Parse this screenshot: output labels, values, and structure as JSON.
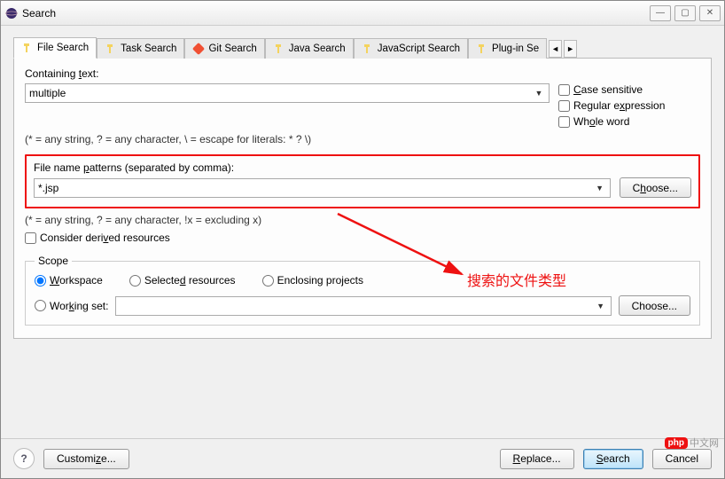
{
  "window": {
    "title": "Search"
  },
  "tabs": [
    {
      "label": "File Search"
    },
    {
      "label": "Task Search"
    },
    {
      "label": "Git Search"
    },
    {
      "label": "Java Search"
    },
    {
      "label": "JavaScript Search"
    },
    {
      "label": "Plug-in Se"
    }
  ],
  "containing": {
    "label": "Containing text:",
    "value": "multiple",
    "hint": "(* = any string, ? = any character, \\ = escape for literals: * ? \\)"
  },
  "checks": {
    "case": "Case sensitive",
    "regex": "Regular expression",
    "whole": "Whole word"
  },
  "patterns": {
    "label": "File name patterns (separated by comma):",
    "value": "*.jsp",
    "choose": "Choose...",
    "hint": "(* = any string, ? = any character, !x = excluding x)"
  },
  "derived": "Consider derived resources",
  "scope": {
    "legend": "Scope",
    "workspace": "Workspace",
    "selected": "Selected resources",
    "enclosing": "Enclosing projects",
    "workingset": "Working set:",
    "choose": "Choose..."
  },
  "footer": {
    "customize": "Customize...",
    "replace": "Replace...",
    "search": "Search",
    "cancel": "Cancel"
  },
  "annotation": "搜索的文件类型",
  "badge": {
    "php": "php",
    "text": "中文网"
  }
}
